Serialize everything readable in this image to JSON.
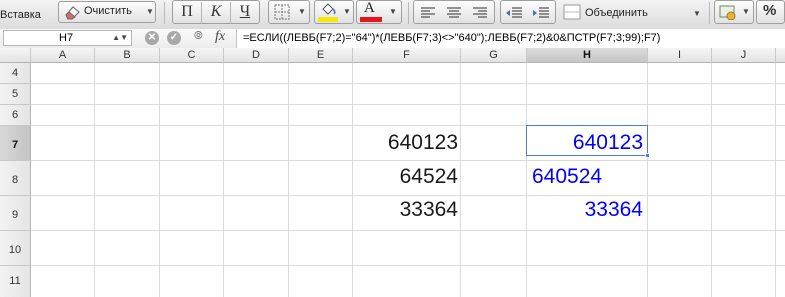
{
  "ribbon": {
    "paste_label": "Вставка",
    "clear_label": "Очистить",
    "bold_label": "П",
    "italic_label": "К",
    "underline_label": "Ч",
    "font_color_letter": "A",
    "merge_label": "Объединить",
    "percent_label": "%"
  },
  "formula_bar": {
    "name_box": "H7",
    "fx_label": "fx",
    "formula": "=ЕСЛИ((ЛЕВБ(F7;2)=\"64\")*(ЛЕВБ(F7;3)<>\"640\");ЛЕВБ(F7;2)&0&ПСТР(F7;3;99);F7)"
  },
  "columns": [
    "A",
    "B",
    "C",
    "D",
    "E",
    "F",
    "G",
    "H",
    "I",
    "J"
  ],
  "selected_column": "H",
  "rows": [
    "4",
    "5",
    "6",
    "7",
    "8",
    "9",
    "10",
    "11"
  ],
  "selected_row": "7",
  "cells": {
    "F7": "640123",
    "F8": "64524",
    "F9": "33364",
    "H7": "640123",
    "H8": "640524",
    "H9": "33364"
  },
  "colors": {
    "result_text": "#0000ff",
    "source_text": "#1a1a1a",
    "selection_border": "#4a7dd4",
    "font_color_bar": "#e8141b",
    "fill_color_bar": "#f5e60f"
  }
}
